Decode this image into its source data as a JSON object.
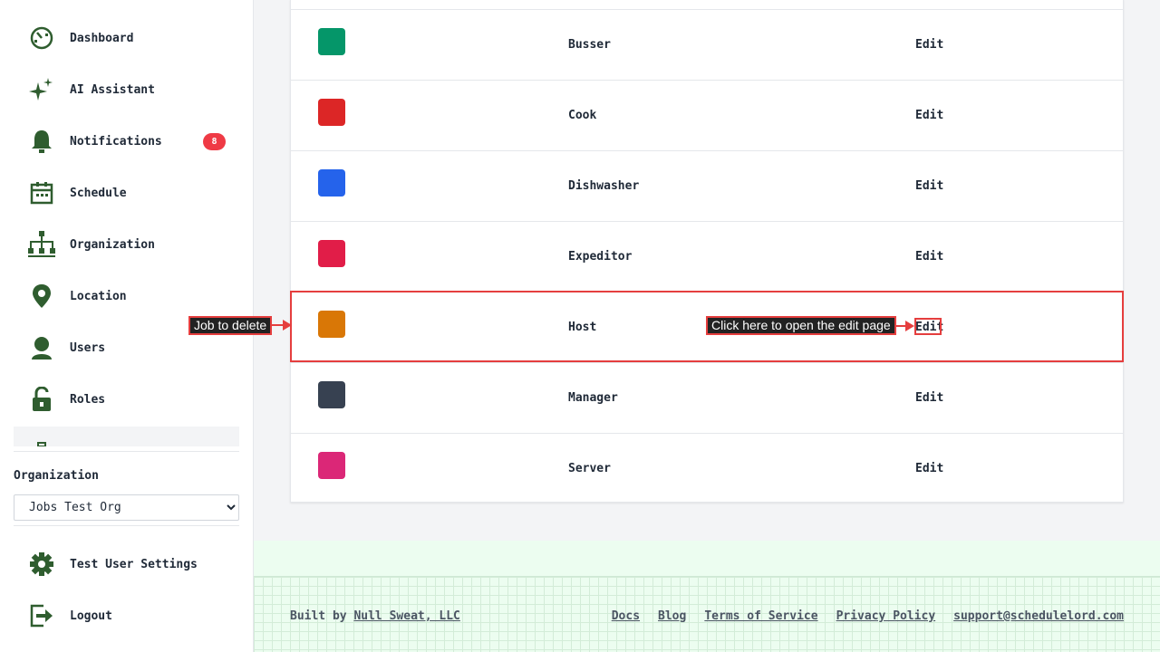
{
  "sidebar": {
    "items": [
      {
        "label": "Dashboard",
        "icon": "dashboard-icon"
      },
      {
        "label": "AI Assistant",
        "icon": "sparkle-icon"
      },
      {
        "label": "Notifications",
        "icon": "bell-icon",
        "badge": "8"
      },
      {
        "label": "Schedule",
        "icon": "calendar-icon"
      },
      {
        "label": "Organization",
        "icon": "org-chart-icon"
      },
      {
        "label": "Location",
        "icon": "location-pin-icon"
      },
      {
        "label": "Users",
        "icon": "user-icon"
      },
      {
        "label": "Roles",
        "icon": "unlock-icon"
      }
    ],
    "organization_label": "Organization",
    "organization_selected": "Jobs Test Org",
    "bottom_items": [
      {
        "label": "Test User Settings",
        "icon": "gear-icon"
      },
      {
        "label": "Logout",
        "icon": "logout-icon"
      }
    ]
  },
  "jobs": [
    {
      "name": "Busser",
      "color": "#059669",
      "action": "Edit"
    },
    {
      "name": "Cook",
      "color": "#dc2626",
      "action": "Edit"
    },
    {
      "name": "Dishwasher",
      "color": "#2563eb",
      "action": "Edit"
    },
    {
      "name": "Expeditor",
      "color": "#e11d48",
      "action": "Edit"
    },
    {
      "name": "Host",
      "color": "#d97706",
      "action": "Edit"
    },
    {
      "name": "Manager",
      "color": "#374151",
      "action": "Edit"
    },
    {
      "name": "Server",
      "color": "#db2777",
      "action": "Edit"
    }
  ],
  "annotations": {
    "job_to_delete": "Job to delete",
    "edit_hint": "Click here to open the edit page"
  },
  "footer": {
    "built_by_prefix": "Built by",
    "built_by_link": "Null Sweat, LLC",
    "links": [
      "Docs",
      "Blog",
      "Terms of Service",
      "Privacy Policy",
      "support@schedulelord.com"
    ]
  },
  "colors": {
    "icon_green": "#2f5d2f",
    "badge_red": "#ef3a45",
    "annotation_red": "#e53e3e",
    "footer_bg": "#ecfdf0"
  }
}
